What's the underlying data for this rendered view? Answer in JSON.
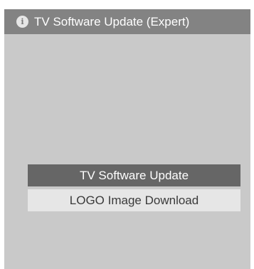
{
  "dialog": {
    "title": "TV Software Update (Expert)",
    "info_icon_glyph": "i",
    "icon": "info-icon"
  },
  "menu": {
    "items": [
      {
        "label": "TV Software Update",
        "selected": true
      },
      {
        "label": "LOGO Image Download",
        "selected": false
      }
    ]
  },
  "colors": {
    "panel_background": "#c9c9c9",
    "title_bar": "#838383",
    "selected_item": "#666666",
    "normal_item": "#e6e6e6"
  }
}
